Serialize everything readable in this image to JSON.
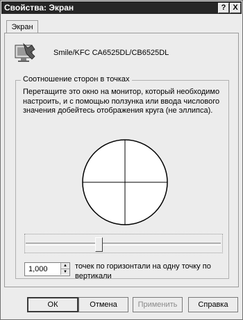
{
  "window": {
    "title": "Свойства: Экран",
    "help_glyph": "?",
    "close_glyph": "X"
  },
  "tabs": [
    {
      "label": "Экран"
    }
  ],
  "device": {
    "name": "Smile/KFC CA6525DL/CB6525DL",
    "icon": "monitor-settings-icon"
  },
  "aspect_group": {
    "label": "Соотношение сторон в точках",
    "instructions": "Перетащите это окно на монитор, который необходимо настроить, и с помощью ползунка или ввода числового значения добейтесь отображения круга (не эллипса)."
  },
  "ratio": {
    "value": "1,000",
    "label": "точек по горизонтали на одну точку по вертикали"
  },
  "buttons": {
    "ok": "ОК",
    "cancel": "Отмена",
    "apply": "Применить",
    "help": "Справка"
  }
}
